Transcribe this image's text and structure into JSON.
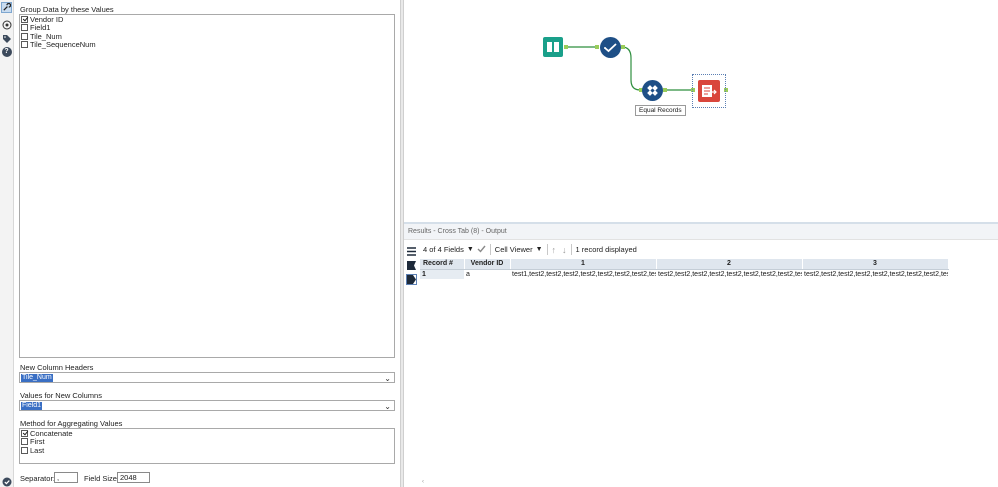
{
  "config": {
    "group_label": "Group Data by these Values",
    "group_fields": [
      {
        "label": "Vendor ID",
        "checked": true
      },
      {
        "label": "Field1",
        "checked": false
      },
      {
        "label": "Tile_Num",
        "checked": false
      },
      {
        "label": "Tile_SequenceNum",
        "checked": false
      }
    ],
    "headers_label": "New Column Headers",
    "headers_value": "Tile_Num",
    "values_label": "Values for New Columns",
    "values_value": "Field1",
    "method_label": "Method for Aggregating Values",
    "methods": [
      {
        "label": "Concatenate",
        "checked": true
      },
      {
        "label": "First",
        "checked": false
      },
      {
        "label": "Last",
        "checked": false
      }
    ],
    "separator_label": "Separator:",
    "separator_value": ",",
    "fieldsize_label": "Field Size:",
    "fieldsize_value": "2048"
  },
  "canvas": {
    "connection_label": "Equal Records"
  },
  "results": {
    "title": "Results - Cross Tab (8) - Output",
    "fields_count": "4 of 4 Fields",
    "viewer": "Cell Viewer",
    "record_status": "1 record displayed",
    "columns": [
      "Record #",
      "Vendor ID",
      "1",
      "2",
      "3"
    ],
    "rows": [
      [
        "1",
        "a",
        "test1,test2,test2,test2,test2,test2,test2,test2,test...",
        "test2,test2,test2,test2,test2,test2,test2,test2,test...",
        "test2,test2,test2,test2,test2,test2,test2,test2,test..."
      ]
    ]
  },
  "colors": {
    "accent": "#3a6fc4",
    "input_tool": "#1aa08a",
    "select_tool": "#1e4f86",
    "output_tool": "#d9463c"
  }
}
